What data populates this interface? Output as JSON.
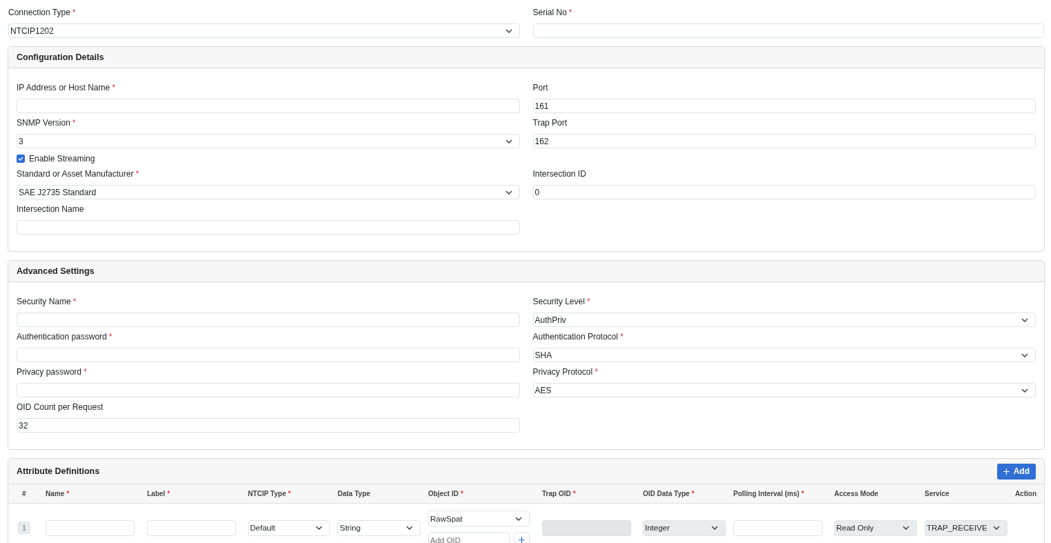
{
  "required_mark": "*",
  "top_fields": [
    {
      "label": "Connection Type",
      "required": true,
      "kind": "select",
      "value": "NTCIP1202"
    },
    {
      "label": "Serial No",
      "required": true,
      "kind": "input"
    }
  ],
  "sections": [
    {
      "title": "Configuration Details",
      "rows": [
        [
          {
            "label": "IP Address or Host Name",
            "required": true,
            "kind": "input"
          },
          {
            "label": "Port",
            "required": false,
            "kind": "input",
            "value": "161"
          }
        ],
        [
          {
            "label": "SNMP Version",
            "required": true,
            "kind": "select",
            "value": "3"
          },
          {
            "label": "Trap Port",
            "required": false,
            "kind": "input",
            "value": "162"
          }
        ],
        [
          {
            "label": "Enable Streaming",
            "kind": "checkbox",
            "checked": true
          }
        ],
        [
          {
            "label": "Standard or Asset Manufacturer",
            "required": true,
            "kind": "select",
            "value": "SAE J2735 Standard"
          },
          {
            "label": "Intersection ID",
            "required": false,
            "kind": "input",
            "value": "0"
          }
        ],
        [
          {
            "label": "Intersection Name",
            "required": false,
            "kind": "input"
          }
        ]
      ]
    },
    {
      "title": "Advanced Settings",
      "rows": [
        [
          {
            "label": "Security Name",
            "required": true,
            "kind": "input"
          },
          {
            "label": "Security Level",
            "required": true,
            "kind": "select",
            "value": "AuthPriv"
          }
        ],
        [
          {
            "label": "Authentication password",
            "required": true,
            "kind": "input"
          },
          {
            "label": "Authentication Protocol",
            "required": true,
            "kind": "select",
            "value": "SHA"
          }
        ],
        [
          {
            "label": "Privacy password",
            "required": true,
            "kind": "input"
          },
          {
            "label": "Privacy Protocol",
            "required": true,
            "kind": "select",
            "value": "AES"
          }
        ],
        [
          {
            "label": "OID Count per Request",
            "required": false,
            "kind": "input",
            "value": "32"
          }
        ]
      ]
    }
  ],
  "attributes": {
    "title": "Attribute Definitions",
    "add_button": "Add",
    "columns": [
      {
        "label": "#",
        "required": false
      },
      {
        "label": "Name",
        "required": true
      },
      {
        "label": "Label",
        "required": true
      },
      {
        "label": "NTCIP Type",
        "required": true
      },
      {
        "label": "Data Type",
        "required": false
      },
      {
        "label": "Object ID",
        "required": true
      },
      {
        "label": "Trap OID",
        "required": true
      },
      {
        "label": "OID Data Type",
        "required": true
      },
      {
        "label": "Polling Interval (ms)",
        "required": true
      },
      {
        "label": "Access Mode",
        "required": false
      },
      {
        "label": "Service",
        "required": false
      },
      {
        "label": "Action",
        "required": false
      }
    ],
    "rows": [
      {
        "cells": [
          {
            "kind": "badge",
            "text": "1"
          },
          {
            "kind": "input",
            "disabled": false
          },
          {
            "kind": "input",
            "disabled": false
          },
          {
            "kind": "select",
            "value": "Default",
            "disabled": false
          },
          {
            "kind": "select",
            "value": "String",
            "disabled": false
          },
          {
            "kind": "oid",
            "value": "RawSpat",
            "placeholder": "Add OID"
          },
          {
            "kind": "input",
            "disabled": true
          },
          {
            "kind": "select",
            "value": "Integer",
            "disabled": true
          },
          {
            "kind": "input",
            "disabled": false
          },
          {
            "kind": "select",
            "value": "Read Only",
            "disabled": true
          },
          {
            "kind": "select",
            "value": "TRAP_RECEIVE",
            "disabled": true
          }
        ]
      }
    ]
  }
}
